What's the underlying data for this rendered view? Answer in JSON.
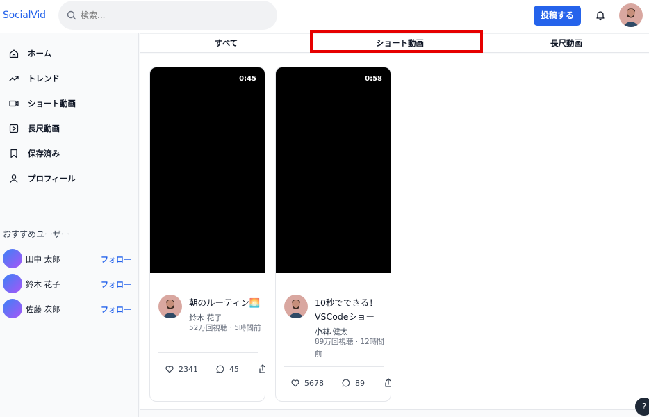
{
  "app": {
    "logo": "SocialVid"
  },
  "search": {
    "placeholder": "検索..."
  },
  "header": {
    "post_label": "投稿する"
  },
  "sidebar": {
    "items": [
      {
        "label": "ホーム",
        "icon": "home-icon"
      },
      {
        "label": "トレンド",
        "icon": "trending-icon"
      },
      {
        "label": "ショート動画",
        "icon": "video-icon"
      },
      {
        "label": "長尺動画",
        "icon": "play-square-icon"
      },
      {
        "label": "保存済み",
        "icon": "bookmark-icon"
      },
      {
        "label": "プロフィール",
        "icon": "user-icon"
      }
    ],
    "recommended_title": "おすすめユーザー",
    "users": [
      {
        "name": "田中 太郎",
        "follow": "フォロー"
      },
      {
        "name": "鈴木 花子",
        "follow": "フォロー"
      },
      {
        "name": "佐藤 次郎",
        "follow": "フォロー"
      }
    ]
  },
  "tabs": [
    {
      "label": "すべて"
    },
    {
      "label": "ショート動画",
      "active": true
    },
    {
      "label": "長尺動画"
    }
  ],
  "videos": [
    {
      "duration": "0:45",
      "title": "朝のルーティン🌅",
      "author": "鈴木 花子",
      "meta": "52万回視聴 · 5時間前",
      "likes": "2341",
      "comments": "45"
    },
    {
      "duration": "0:58",
      "title": "10秒でできる！VSCodeショート…",
      "author": "小林 健太",
      "meta": "89万回視聴 · 12時間前",
      "likes": "5678",
      "comments": "89"
    }
  ],
  "help": {
    "label": "?"
  },
  "colors": {
    "accent": "#2563eb",
    "highlight": "#e60000"
  }
}
